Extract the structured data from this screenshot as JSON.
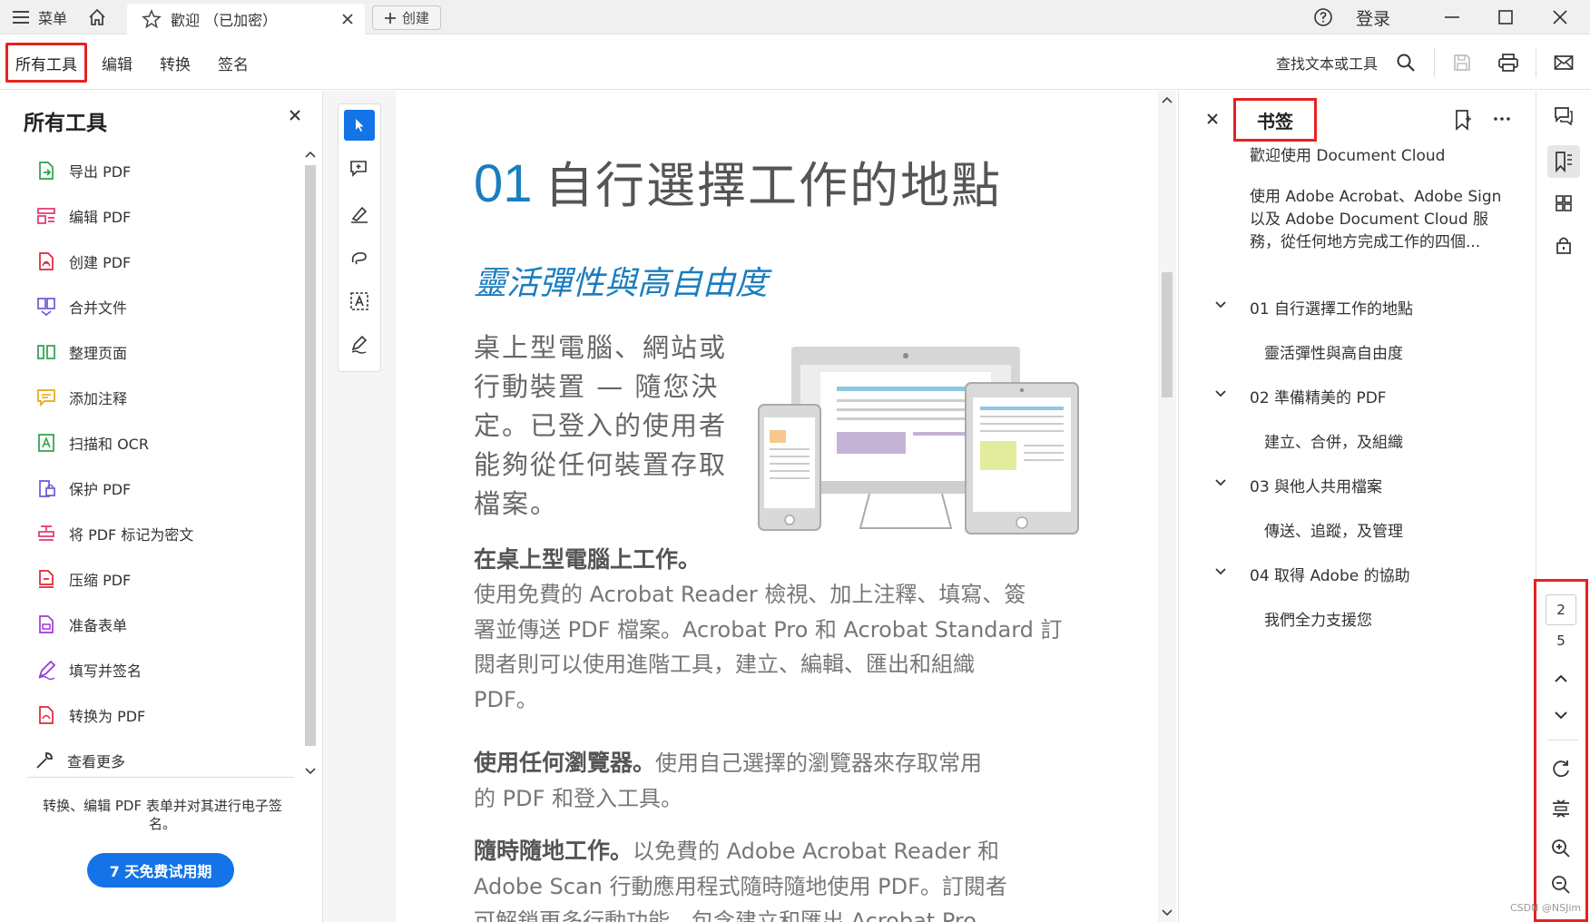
{
  "titlebar": {
    "menu_label": "菜单",
    "tab_title": "歡迎 （已加密）",
    "create_label": "创建",
    "login_label": "登录"
  },
  "toolbar": {
    "tabs": [
      "所有工具",
      "编辑",
      "转换",
      "签名"
    ],
    "search_label": "查找文本或工具"
  },
  "leftpanel": {
    "title": "所有工具",
    "items": [
      {
        "label": "导出 PDF",
        "color": "#2aa14a"
      },
      {
        "label": "编辑 PDF",
        "color": "#e0356b"
      },
      {
        "label": "创建 PDF",
        "color": "#e0243a"
      },
      {
        "label": "合并文件",
        "color": "#6a5bd8"
      },
      {
        "label": "整理页面",
        "color": "#2aa14a"
      },
      {
        "label": "添加注释",
        "color": "#e8a417"
      },
      {
        "label": "扫描和 OCR",
        "color": "#2aa14a"
      },
      {
        "label": "保护 PDF",
        "color": "#6a5bd8"
      },
      {
        "label": "将 PDF 标记为密文",
        "color": "#e0356b"
      },
      {
        "label": "压缩 PDF",
        "color": "#e0243a"
      },
      {
        "label": "准备表单",
        "color": "#a23bd1"
      },
      {
        "label": "填写并签名",
        "color": "#8e3bd1"
      },
      {
        "label": "转换为 PDF",
        "color": "#e0243a"
      }
    ],
    "more_label": "查看更多",
    "promo_text": "转换、编辑 PDF 表单并对其进行电子签名。",
    "trial_label": "7 天免费试用期"
  },
  "document": {
    "heading_num": "01",
    "heading_text": "自行選擇工作的地點",
    "subheading": "靈活彈性與高自由度",
    "intro_lines": [
      "桌上型電腦、網站或",
      "行動裝置 — 隨您決",
      "定。已登入的使用者",
      "能夠從任何裝置存取",
      "檔案。"
    ],
    "s1_title": "在桌上型電腦上工作。",
    "s1_lines": [
      "使用免費的 Acrobat Reader 檢視、加上注釋、填寫、簽",
      "署並傳送 PDF 檔案。Acrobat Pro 和 Acrobat Standard 訂",
      "閱者則可以使用進階工具，建立、編輯、匯出和組織",
      "PDF。"
    ],
    "s2_title": "使用任何瀏覽器。",
    "s2_rest": "使用自己選擇的瀏覽器來存取常用",
    "s2_line2": "的 PDF 和登入工具。",
    "s3_title": "隨時隨地工作。",
    "s3_rest": "以免費的 Adobe Acrobat Reader 和",
    "s3_line2": "Adobe Scan 行動應用程式隨時隨地使用 PDF。訂閱者",
    "s3_line3": "可解鎖更多行動功能，包含建立和匯出 Acrobat Pro"
  },
  "bookmarks": {
    "title": "书签",
    "items": [
      {
        "label": "歡迎使用 Document Cloud"
      },
      {
        "label": "使用 Adobe Acrobat、Adobe Sign 以及 Adobe Document Cloud 服務，從任何地方完成工作的四個..."
      },
      {
        "label": "01 自行選擇工作的地點"
      },
      {
        "label": "靈活彈性與高自由度"
      },
      {
        "label": "02 準備精美的 PDF"
      },
      {
        "label": "建立、合併，及組織"
      },
      {
        "label": "03 與他人共用檔案"
      },
      {
        "label": "傳送、追蹤，及管理"
      },
      {
        "label": "04 取得 Adobe 的協助"
      },
      {
        "label": "我們全力支援您"
      }
    ],
    "bm1_line1": "使用 Adobe Acrobat、Adobe Sign",
    "bm1_line2": "以及 Adobe Document Cloud 服",
    "bm1_line3": "務，從任何地方完成工作的四個..."
  },
  "nav": {
    "current_page": "2",
    "total_pages": "5"
  },
  "watermark": "CSDN @NSJim",
  "colors": {
    "accent_red": "#e62222",
    "brand_blue": "#1473e6",
    "heading_blue": "#1a7dbf"
  }
}
